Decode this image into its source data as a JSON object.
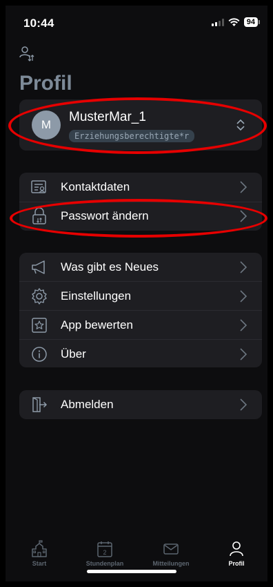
{
  "status_bar": {
    "time": "10:44",
    "battery": "94"
  },
  "header": {
    "title": "Profil",
    "switch_icon": "person-switch-icon"
  },
  "profile": {
    "avatar_letter": "M",
    "name": "MusterMar_1",
    "role": "Erziehungsberechtigte*r"
  },
  "account_section": {
    "items": [
      {
        "label": "Kontaktdaten",
        "icon": "contact-card-icon"
      },
      {
        "label": "Passwort ändern",
        "icon": "lock-icon"
      }
    ]
  },
  "info_section": {
    "items": [
      {
        "label": "Was gibt es Neues",
        "icon": "megaphone-icon"
      },
      {
        "label": "Einstellungen",
        "icon": "gear-icon"
      },
      {
        "label": "App bewerten",
        "icon": "star-icon"
      },
      {
        "label": "Über",
        "icon": "info-icon"
      }
    ]
  },
  "logout": {
    "label": "Abmelden",
    "icon": "logout-icon"
  },
  "tabbar": {
    "tabs": [
      {
        "label": "Start",
        "icon": "school-icon"
      },
      {
        "label": "Stundenplan",
        "icon": "calendar-icon"
      },
      {
        "label": "Mitteilungen",
        "icon": "envelope-icon"
      },
      {
        "label": "Profil",
        "icon": "person-icon"
      }
    ],
    "active": "Profil",
    "calendar_day": "2"
  },
  "colors": {
    "annotation_red": "#e60000",
    "title_gray": "#7d8a98",
    "card_bg": "#1e1e22"
  }
}
